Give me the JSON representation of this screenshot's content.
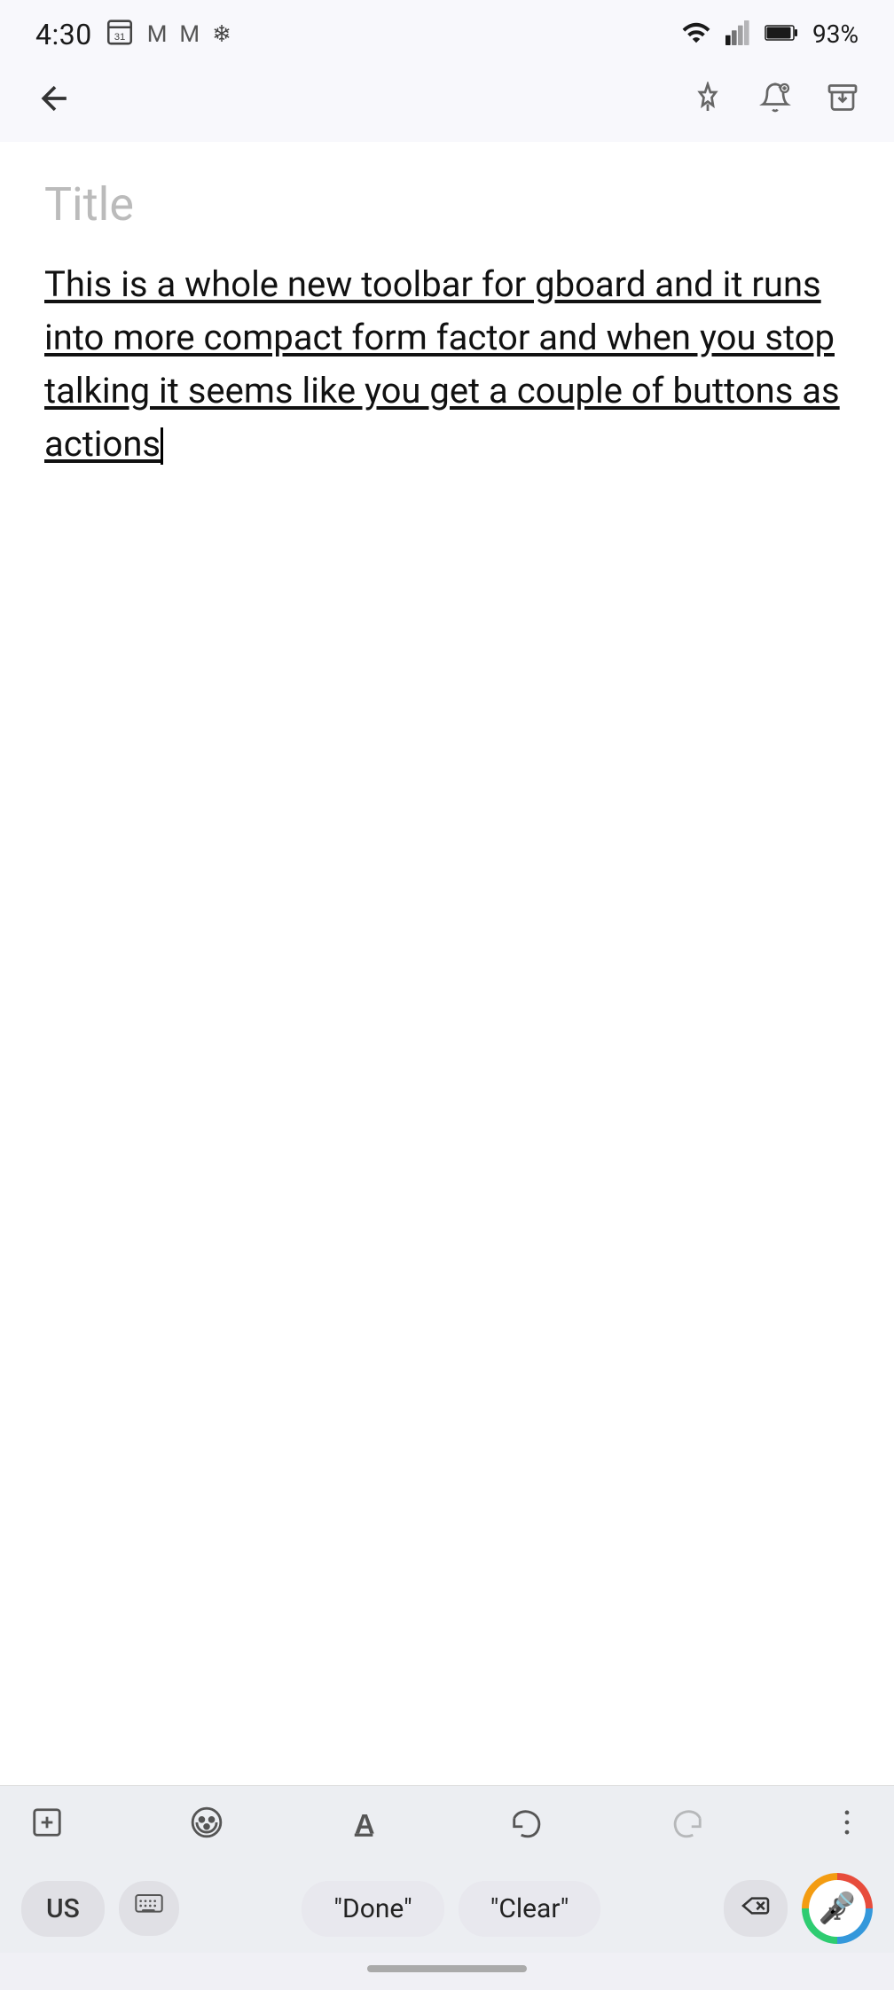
{
  "statusBar": {
    "time": "4:30",
    "icons": [
      "calendar-31-icon",
      "gmail-icon",
      "gmail-m-icon",
      "snow-icon"
    ],
    "wifi": "wifi-icon",
    "signal": "signal-icon",
    "battery": "93%"
  },
  "topBar": {
    "back_label": "←",
    "pin_icon": "pin-icon",
    "bell_add_icon": "bell-add-icon",
    "archive_icon": "archive-icon"
  },
  "note": {
    "title_placeholder": "Title",
    "body_text": "This is a whole new toolbar for gboard and it runs into more compact form factor and when you stop talking it seems like you get a couple of buttons as actions"
  },
  "keyboardToolbar": {
    "add_icon": "add-icon",
    "palette_icon": "palette-icon",
    "text_format_icon": "text-format-icon",
    "undo_icon": "undo-icon",
    "redo_icon": "redo-icon",
    "more_icon": "more-vert-icon"
  },
  "keyboardSuggestions": {
    "language": "US",
    "keyboard_icon": "keyboard-icon",
    "suggestions": [
      "\"Done\"",
      "\"Clear\""
    ],
    "backspace_icon": "backspace-icon",
    "mic_icon": "mic-icon"
  }
}
